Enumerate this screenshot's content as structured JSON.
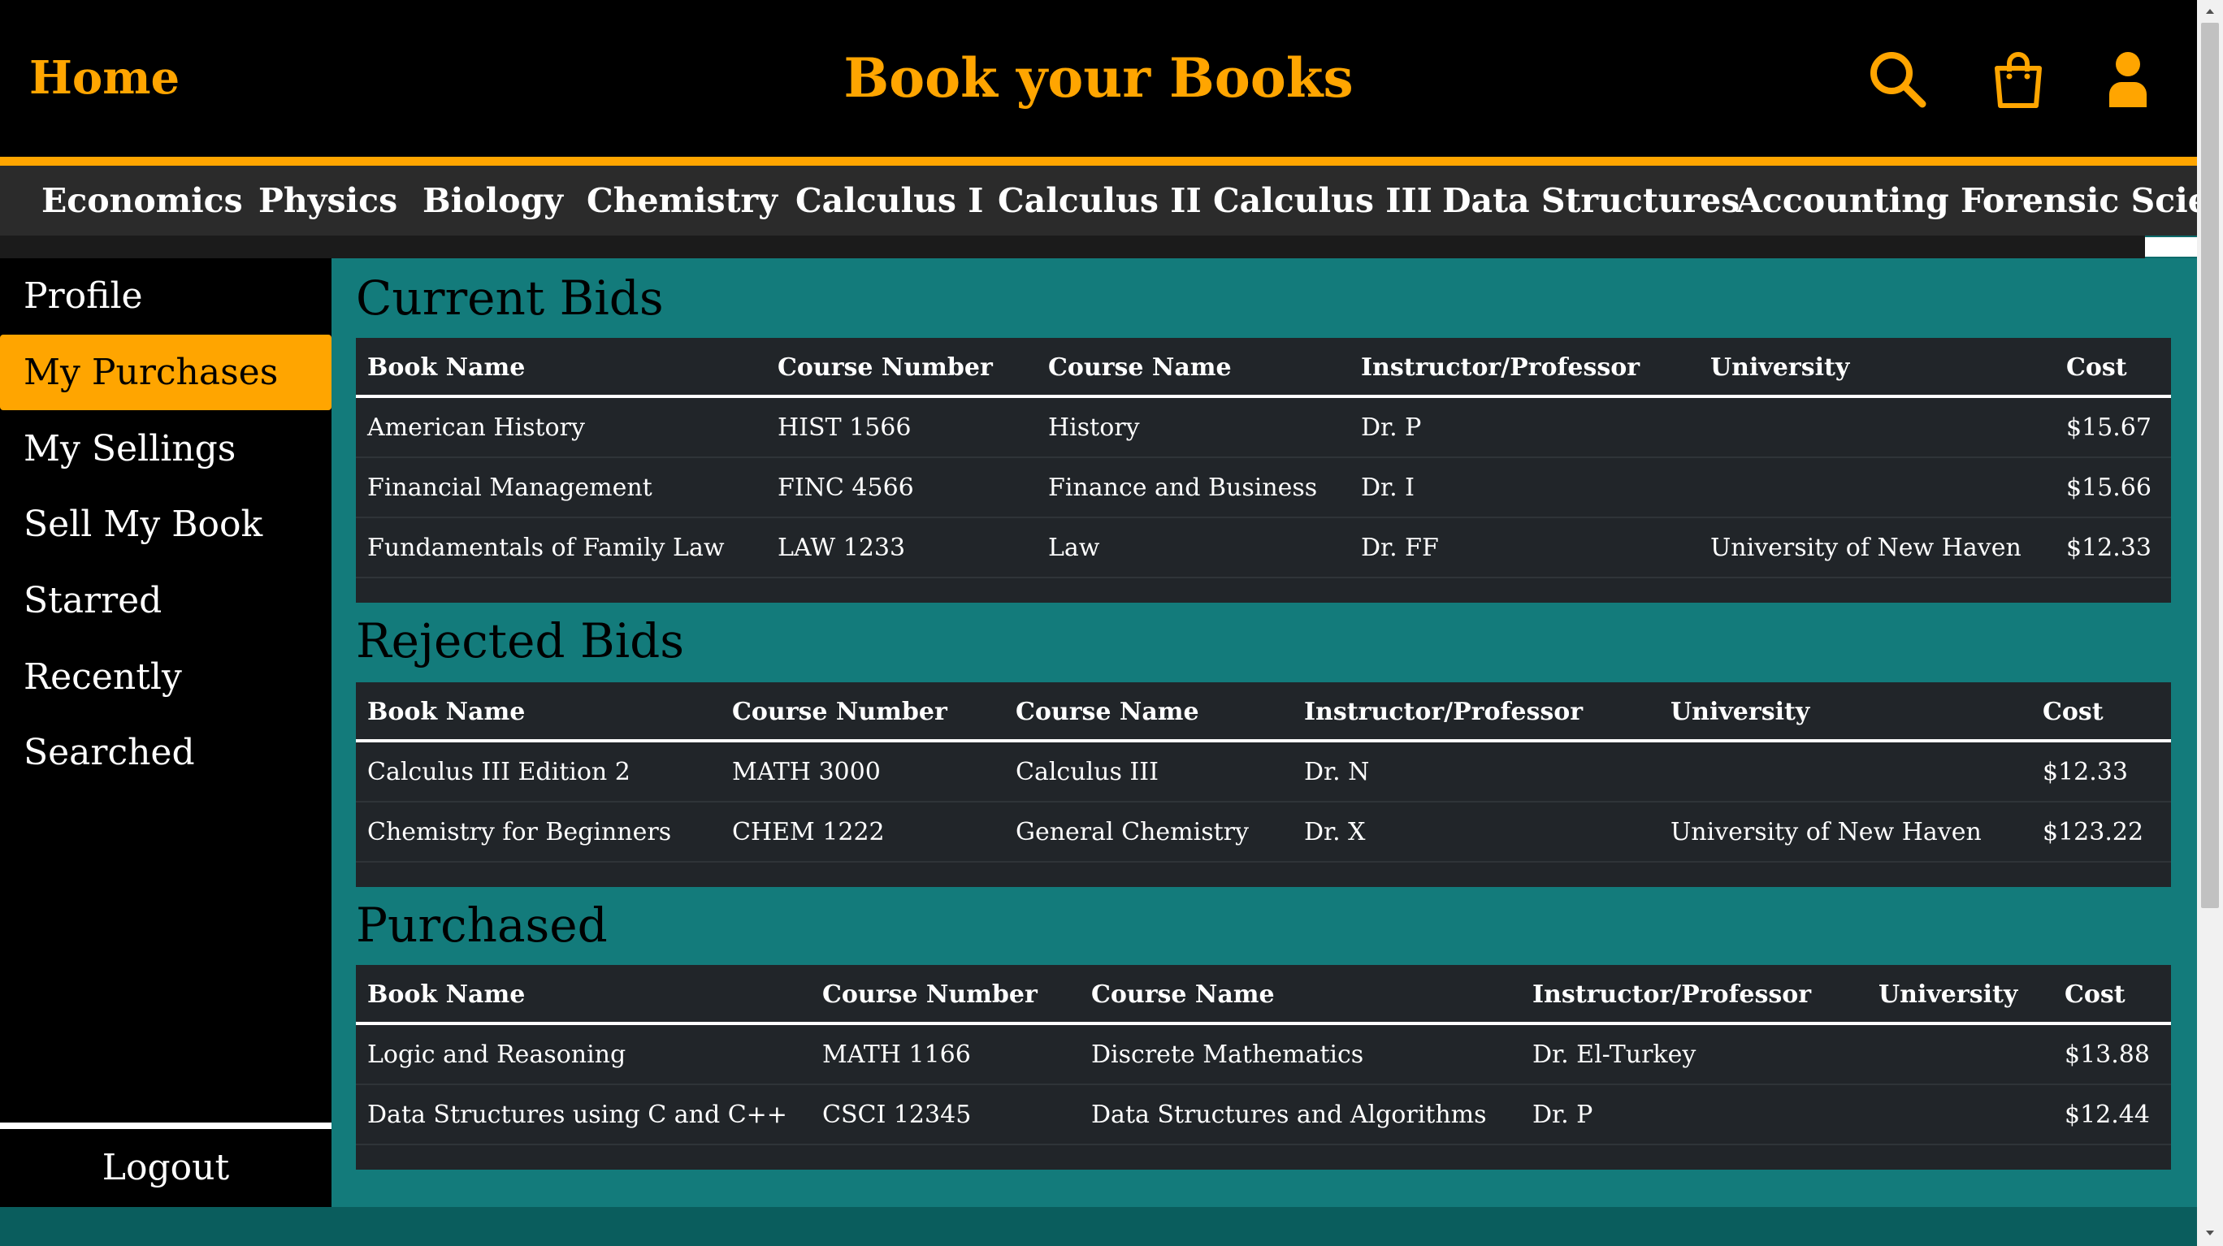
{
  "header": {
    "home_label": "Home",
    "title": "Book your Books",
    "icons": [
      "search-icon",
      "shopping-bag-icon",
      "user-icon"
    ],
    "accent_color": "#ffa500"
  },
  "categories": [
    "Economics",
    "Physics",
    "Biology",
    "Chemistry",
    "Calculus I",
    "Calculus II",
    "Calculus III",
    "Data Structures",
    "Accounting",
    "Forensic Science"
  ],
  "sidebar": {
    "items": [
      {
        "label": "Profile",
        "active": false
      },
      {
        "label": "My Purchases",
        "active": true
      },
      {
        "label": "My Sellings",
        "active": false
      },
      {
        "label": "Sell My Book",
        "active": false
      },
      {
        "label": "Starred",
        "active": false
      },
      {
        "label": "Recently Searched",
        "active": false
      }
    ],
    "logout_label": "Logout"
  },
  "columns": [
    "Book Name",
    "Course Number",
    "Course Name",
    "Instructor/Professor",
    "University",
    "Cost"
  ],
  "sections": [
    {
      "title": "Current Bids",
      "rows": [
        [
          "American History",
          "HIST 1566",
          "History",
          "Dr. P",
          "",
          "$15.67"
        ],
        [
          "Financial Management",
          "FINC 4566",
          "Finance and Business",
          "Dr. I",
          "",
          "$15.66"
        ],
        [
          "Fundamentals of Family Law",
          "LAW 1233",
          "Law",
          "Dr. FF",
          "University of New Haven",
          "$12.33"
        ]
      ]
    },
    {
      "title": "Rejected Bids",
      "rows": [
        [
          "Calculus III Edition 2",
          "MATH 3000",
          "Calculus III",
          "Dr. N",
          "",
          "$12.33"
        ],
        [
          "Chemistry for Beginners",
          "CHEM 1222",
          "General Chemistry",
          "Dr. X",
          "University of New Haven",
          "$123.22"
        ]
      ]
    },
    {
      "title": "Purchased",
      "rows": [
        [
          "Logic and Reasoning",
          "MATH 1166",
          "Discrete Mathematics",
          "Dr. El-Turkey",
          "",
          "$13.88"
        ],
        [
          "Data Structures using C and C++",
          "CSCI 12345",
          "Data Structures and Algorithms",
          "Dr. P",
          "",
          "$12.44"
        ]
      ]
    }
  ]
}
